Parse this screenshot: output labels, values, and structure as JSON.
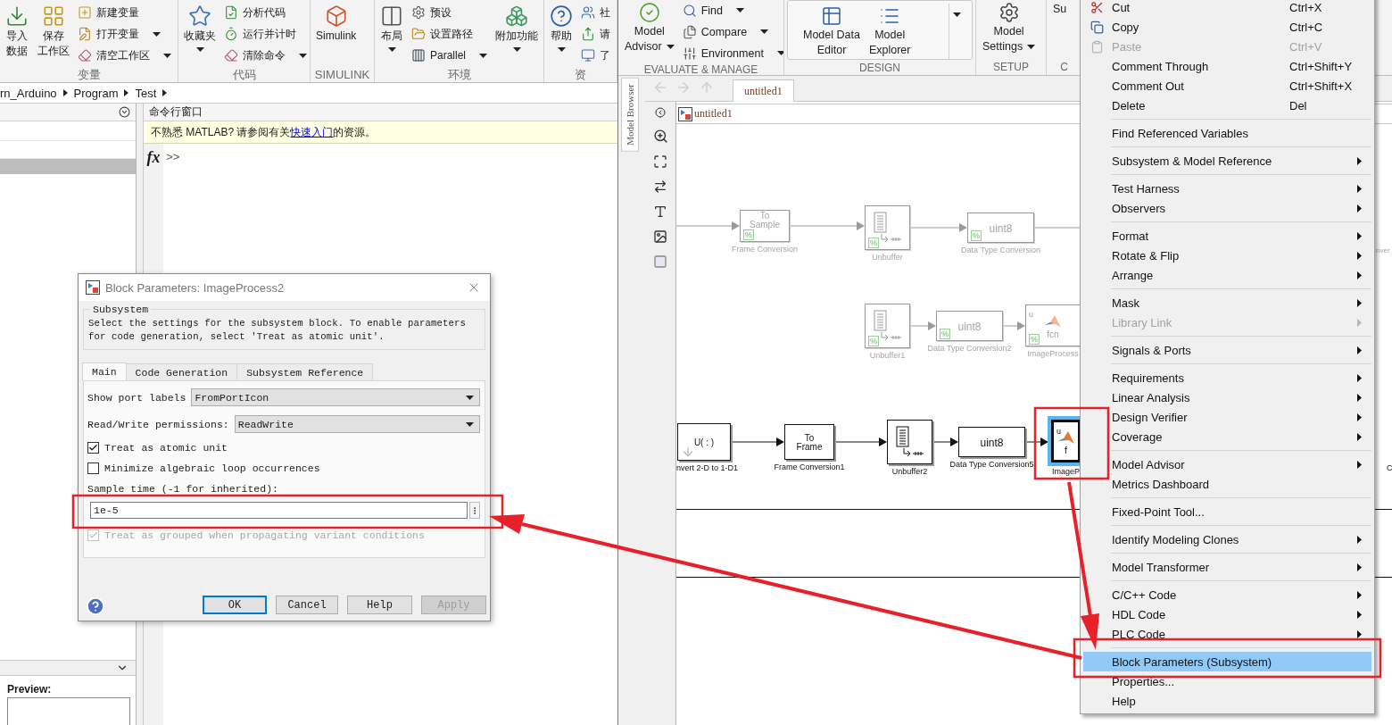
{
  "matlab": {
    "ribbon": {
      "groups": [
        {
          "label": "变量",
          "items": [
            {
              "kind": "large",
              "lines": [
                "导入",
                "数据"
              ],
              "dropdown": false
            },
            {
              "kind": "large",
              "lines": [
                "保存",
                "工作区"
              ],
              "dropdown": false
            },
            {
              "kind": "small",
              "label": "新建变量",
              "dropdown": false
            },
            {
              "kind": "small",
              "label": "打开变量",
              "dropdown": true
            },
            {
              "kind": "small",
              "label": "清空工作区",
              "dropdown": true
            }
          ]
        },
        {
          "label": "代码",
          "items": [
            {
              "kind": "large",
              "lines": [
                "收藏夹"
              ],
              "dropdown": true
            },
            {
              "kind": "small",
              "label": "分析代码",
              "dropdown": false
            },
            {
              "kind": "small",
              "label": "运行并计时",
              "dropdown": false
            },
            {
              "kind": "small",
              "label": "清除命令",
              "dropdown": true
            }
          ]
        },
        {
          "label": "SIMULINK",
          "items": [
            {
              "kind": "large",
              "lines": [
                "Simulink"
              ],
              "dropdown": false
            }
          ]
        },
        {
          "label": "环境",
          "items": [
            {
              "kind": "large",
              "lines": [
                "布局"
              ],
              "dropdown": true
            },
            {
              "kind": "small",
              "label": "预设",
              "dropdown": false
            },
            {
              "kind": "small",
              "label": "设置路径",
              "dropdown": false
            },
            {
              "kind": "small",
              "label": "Parallel",
              "dropdown": true
            },
            {
              "kind": "large",
              "lines": [
                "附加功能"
              ],
              "dropdown": true
            }
          ]
        },
        {
          "label": "资",
          "items": [
            {
              "kind": "large",
              "lines": [
                "帮助"
              ],
              "dropdown": true
            },
            {
              "kind": "small",
              "label": "社",
              "dropdown": false
            },
            {
              "kind": "small",
              "label": "请",
              "dropdown": false
            },
            {
              "kind": "small",
              "label": "了",
              "dropdown": false
            }
          ]
        }
      ]
    },
    "address": [
      "rn_Arduino",
      "Program",
      "Test"
    ],
    "folder_panel": {
      "rows": [
        {
          "selected": false
        },
        {
          "selected": false
        },
        {
          "selected": true
        }
      ],
      "preview_label": "Preview:"
    },
    "command_window": {
      "title": "命令行窗口",
      "notice": {
        "text_before": "不熟悉 MATLAB? 请参阅有关",
        "link": "快速入门",
        "text_after": "的资源。"
      },
      "fx": "fx",
      "prompt": ">>"
    }
  },
  "simulink": {
    "ribbon": {
      "groups": [
        {
          "label": "EVALUATE & MANAGE",
          "gallery": false,
          "items": [
            {
              "kind": "large",
              "lines": [
                "Model",
                "Advisor"
              ],
              "dropdown": true
            },
            {
              "kind": "small",
              "label": "Find",
              "dropdown": true
            },
            {
              "kind": "small",
              "label": "Compare",
              "dropdown": true
            },
            {
              "kind": "small",
              "label": "Environment",
              "dropdown": true
            }
          ]
        },
        {
          "label": "DESIGN",
          "gallery": true,
          "items": [
            {
              "kind": "large",
              "lines": [
                "Model Data",
                "Editor"
              ],
              "dropdown": false
            },
            {
              "kind": "large",
              "lines": [
                "Model",
                "Explorer"
              ],
              "dropdown": false
            },
            {
              "kind": "expander",
              "dropdown": true
            }
          ]
        },
        {
          "label": "SETUP",
          "gallery": false,
          "items": [
            {
              "kind": "large",
              "lines": [
                "Model",
                "Settings"
              ],
              "dropdown": true
            }
          ]
        },
        {
          "label": "C",
          "gallery": false,
          "items": [
            {
              "kind": "large",
              "lines": [
                "Su"
              ],
              "dropdown": false
            }
          ]
        }
      ]
    },
    "browser_tab": "Model Browser",
    "tabs": [
      {
        "label": "untitled1",
        "selected": true
      }
    ],
    "breadcrumb": "untitled1",
    "diagram": {
      "blocks": [
        {
          "kind": "text",
          "text": "To\nSample",
          "label": "Frame Conversion",
          "commented": true,
          "comment_mark": "%",
          "selected": false
        },
        {
          "kind": "unbuffer",
          "label": "Unbuffer",
          "commented": true,
          "comment_mark": "%",
          "selected": false
        },
        {
          "kind": "text",
          "text": "uint8",
          "label": "Data Type Conversion",
          "commented": true,
          "comment_mark": "%",
          "selected": false
        },
        {
          "kind": "unbuffer",
          "label": "Unbuffer1",
          "commented": true,
          "comment_mark": "%",
          "selected": false
        },
        {
          "kind": "text",
          "text": "uint8",
          "label": "Data Type Conversion2",
          "commented": true,
          "comment_mark": "%",
          "selected": false
        },
        {
          "kind": "function",
          "port": "u",
          "text": "fcn",
          "label": "ImageProcess",
          "commented": true,
          "comment_mark": "%",
          "selected": false
        },
        {
          "kind": "text",
          "text": "U( : )",
          "label": "nvert 2-D to 1-D1",
          "commented": false,
          "selected": false
        },
        {
          "kind": "text",
          "text": "To\nFrame",
          "label": "Frame Conversion1",
          "commented": false,
          "selected": false
        },
        {
          "kind": "unbuffer",
          "label": "Unbuffer2",
          "commented": false,
          "selected": false
        },
        {
          "kind": "text",
          "text": "uint8",
          "label": "Data Type Conversion5",
          "commented": false,
          "selected": false
        },
        {
          "kind": "function",
          "port": "u",
          "text": "f",
          "label": "ImageP",
          "commented": false,
          "selected": true
        }
      ],
      "fragments": [
        "nver",
        "C"
      ]
    }
  },
  "context_menu": {
    "groups": [
      [
        {
          "label": "Cut",
          "shortcut": "Ctrl+X",
          "submenu": false,
          "disabled": false,
          "selected": false
        },
        {
          "label": "Copy",
          "shortcut": "Ctrl+C",
          "submenu": false,
          "disabled": false,
          "selected": false
        },
        {
          "label": "Paste",
          "shortcut": "Ctrl+V",
          "submenu": false,
          "disabled": true,
          "selected": false
        },
        {
          "label": "Comment Through",
          "shortcut": "Ctrl+Shift+Y",
          "submenu": false,
          "disabled": false,
          "selected": false
        },
        {
          "label": "Comment Out",
          "shortcut": "Ctrl+Shift+X",
          "submenu": false,
          "disabled": false,
          "selected": false
        },
        {
          "label": "Delete",
          "shortcut": "Del",
          "submenu": false,
          "disabled": false,
          "selected": false
        }
      ],
      [
        {
          "label": "Find Referenced Variables",
          "submenu": false,
          "disabled": false,
          "selected": false
        }
      ],
      [
        {
          "label": "Subsystem & Model Reference",
          "submenu": true,
          "disabled": false,
          "selected": false
        }
      ],
      [
        {
          "label": "Test Harness",
          "submenu": true,
          "disabled": false,
          "selected": false
        },
        {
          "label": "Observers",
          "submenu": true,
          "disabled": false,
          "selected": false
        }
      ],
      [
        {
          "label": "Format",
          "submenu": true,
          "disabled": false,
          "selected": false
        },
        {
          "label": "Rotate & Flip",
          "submenu": true,
          "disabled": false,
          "selected": false
        },
        {
          "label": "Arrange",
          "submenu": true,
          "disabled": false,
          "selected": false
        }
      ],
      [
        {
          "label": "Mask",
          "submenu": true,
          "disabled": false,
          "selected": false
        },
        {
          "label": "Library Link",
          "submenu": true,
          "disabled": true,
          "selected": false
        }
      ],
      [
        {
          "label": "Signals & Ports",
          "submenu": true,
          "disabled": false,
          "selected": false
        }
      ],
      [
        {
          "label": "Requirements",
          "submenu": true,
          "disabled": false,
          "selected": false
        },
        {
          "label": "Linear Analysis",
          "submenu": true,
          "disabled": false,
          "selected": false
        },
        {
          "label": "Design Verifier",
          "submenu": true,
          "disabled": false,
          "selected": false
        },
        {
          "label": "Coverage",
          "submenu": true,
          "disabled": false,
          "selected": false
        }
      ],
      [
        {
          "label": "Model Advisor",
          "submenu": true,
          "disabled": false,
          "selected": false
        },
        {
          "label": "Metrics Dashboard",
          "submenu": false,
          "disabled": false,
          "selected": false
        }
      ],
      [
        {
          "label": "Fixed-Point Tool...",
          "submenu": false,
          "disabled": false,
          "selected": false
        }
      ],
      [
        {
          "label": "Identify Modeling Clones",
          "submenu": true,
          "disabled": false,
          "selected": false
        }
      ],
      [
        {
          "label": "Model Transformer",
          "submenu": true,
          "disabled": false,
          "selected": false
        }
      ],
      [
        {
          "label": "C/C++ Code",
          "submenu": true,
          "disabled": false,
          "selected": false
        },
        {
          "label": "HDL Code",
          "submenu": true,
          "disabled": false,
          "selected": false
        },
        {
          "label": "PLC Code",
          "submenu": true,
          "disabled": false,
          "selected": false
        }
      ],
      [
        {
          "label": "Block Parameters (Subsystem)",
          "submenu": false,
          "disabled": false,
          "selected": true
        },
        {
          "label": "Properties...",
          "submenu": false,
          "disabled": false,
          "selected": false
        },
        {
          "label": "Help",
          "submenu": false,
          "disabled": false,
          "selected": false
        }
      ]
    ]
  },
  "dialog": {
    "title": "Block Parameters: ImageProcess2",
    "section": "Subsystem",
    "description": "Select the settings for the subsystem block. To enable parameters for code generation, select 'Treat as atomic unit'.",
    "tabs": [
      {
        "label": "Main",
        "selected": true
      },
      {
        "label": "Code Generation",
        "selected": false
      },
      {
        "label": "Subsystem Reference",
        "selected": false
      }
    ],
    "fields": [
      {
        "kind": "select",
        "label": "Show port labels",
        "value": "FromPortIcon"
      },
      {
        "kind": "select",
        "label": "Read/Write permissions:",
        "value": "ReadWrite"
      },
      {
        "kind": "checkbox",
        "label": "Treat as atomic unit",
        "checked": true,
        "disabled": false
      },
      {
        "kind": "checkbox",
        "label": "Minimize algebraic loop occurrences",
        "checked": false,
        "disabled": false
      },
      {
        "kind": "text",
        "label": "Sample time (-1 for inherited):",
        "value": "1e-5"
      },
      {
        "kind": "checkbox",
        "label": "Treat as grouped when propagating variant conditions",
        "checked": true,
        "disabled": true
      }
    ],
    "buttons": [
      {
        "label": "OK",
        "focused": true,
        "disabled": false
      },
      {
        "label": "Cancel",
        "focused": false,
        "disabled": false
      },
      {
        "label": "Help",
        "focused": false,
        "disabled": false
      },
      {
        "label": "Apply",
        "focused": false,
        "disabled": true
      }
    ]
  }
}
